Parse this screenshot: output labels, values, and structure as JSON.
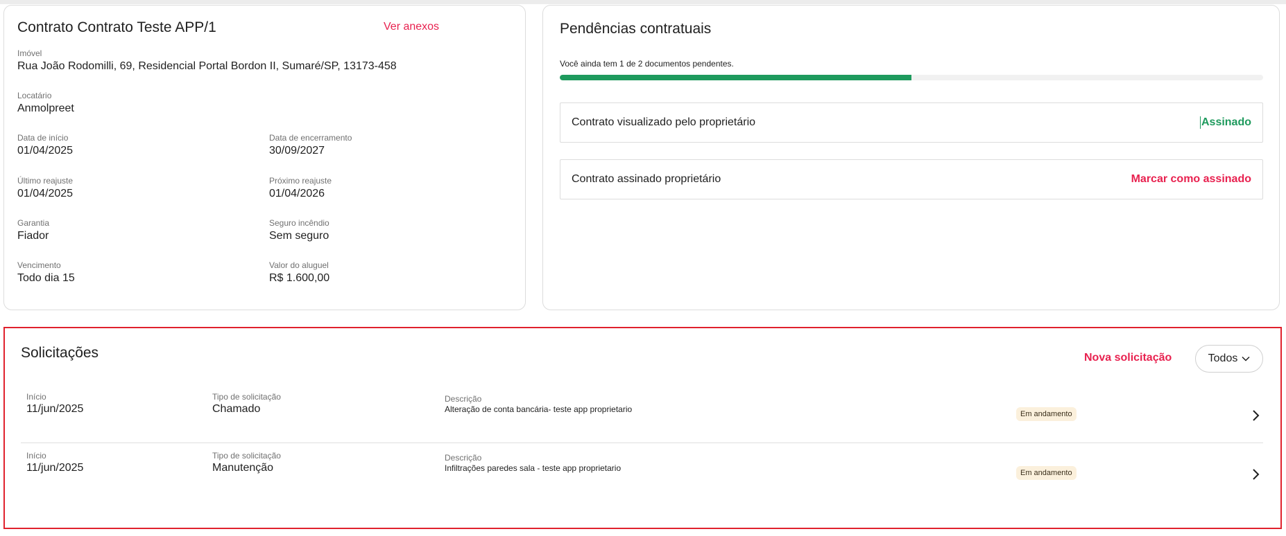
{
  "contract": {
    "title": "Contrato Contrato Teste APP/1",
    "attachments_link": "Ver anexos",
    "property_label": "Imóvel",
    "property_value": "Rua João Rodomilli, 69, Residencial Portal Bordon II, Sumaré/SP, 13173-458",
    "tenant_label": "Locatário",
    "tenant_value": "Anmolpreet",
    "start_label": "Data de início",
    "start_value": "01/04/2025",
    "end_label": "Data de encerramento",
    "end_value": "30/09/2027",
    "last_adjust_label": "Último reajuste",
    "last_adjust_value": "01/04/2025",
    "next_adjust_label": "Próximo reajuste",
    "next_adjust_value": "01/04/2026",
    "guarantee_label": "Garantia",
    "guarantee_value": "Fiador",
    "insurance_label": "Seguro incêndio",
    "insurance_value": "Sem seguro",
    "due_label": "Vencimento",
    "due_value": "Todo dia 15",
    "rent_label": "Valor do aluguel",
    "rent_value": "R$ 1.600,00"
  },
  "pending": {
    "title": "Pendências contratuais",
    "summary": "Você ainda tem 1 de 2 documentos pendentes.",
    "progress_fraction": 0.5,
    "items": [
      {
        "name": "Contrato visualizado pelo proprietário",
        "status": "Assinado"
      },
      {
        "name": "Contrato assinado proprietário",
        "status": "Marcar como assinado"
      }
    ]
  },
  "requests": {
    "title": "Solicitações",
    "new_request": "Nova solicitação",
    "filter_label": "Todos",
    "rows": [
      {
        "start_label": "Início",
        "start_value": "11/jun/2025",
        "type_label": "Tipo de solicitação",
        "type_value": "Chamado",
        "desc_label": "Descrição",
        "desc_value": "Alteração de conta bancária- teste app proprietario",
        "status": "Em andamento"
      },
      {
        "start_label": "Início",
        "start_value": "11/jun/2025",
        "type_label": "Tipo de solicitação",
        "type_value": "Manutenção",
        "desc_label": "Descrição",
        "desc_value": "Infiltrações paredes sala - teste app proprietario",
        "status": "Em andamento"
      }
    ]
  },
  "colors": {
    "accent_red": "#e8214f",
    "success_green": "#1e9a5d",
    "highlight_border": "#e0212d",
    "badge_bg": "#fbf0dc"
  }
}
